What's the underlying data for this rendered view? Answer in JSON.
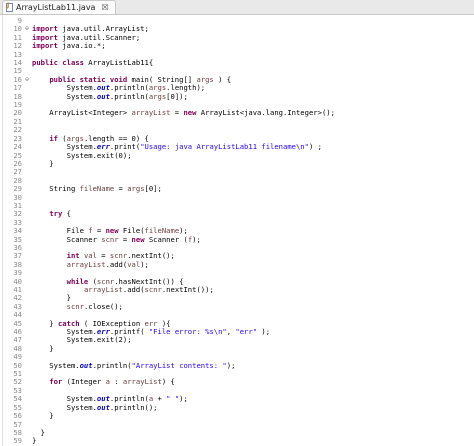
{
  "tab": {
    "title": "ArrayListLab11.java",
    "close_symbol": "☒"
  },
  "lines": [
    {
      "n": "9",
      "fold": "",
      "code": []
    },
    {
      "n": "10",
      "fold": "⊖",
      "code": [
        [
          "kw",
          "import"
        ],
        [
          "",
          "java.util.ArrayList;"
        ]
      ]
    },
    {
      "n": "11",
      "fold": "",
      "code": [
        [
          "kw",
          "import"
        ],
        [
          "",
          "java.util.Scanner;"
        ]
      ]
    },
    {
      "n": "12",
      "fold": "",
      "code": [
        [
          "kw",
          "import"
        ],
        [
          "",
          "java.io.*;"
        ]
      ]
    },
    {
      "n": "13",
      "fold": "",
      "code": []
    },
    {
      "n": "14",
      "fold": "",
      "code": [
        [
          "kw",
          "public class"
        ],
        [
          "",
          "ArrayListLab11{"
        ]
      ]
    },
    {
      "n": "15",
      "fold": "",
      "code": []
    },
    {
      "n": "16",
      "fold": "⊖",
      "code": [
        [
          "",
          "    "
        ],
        [
          "kw",
          "public static void"
        ],
        [
          "",
          "main( String[] "
        ],
        [
          "var",
          "args"
        ],
        [
          "",
          " ) {"
        ]
      ]
    },
    {
      "n": "17",
      "fold": "",
      "code": [
        [
          "",
          "        System."
        ],
        [
          "fld",
          "out"
        ],
        [
          "",
          ".println("
        ],
        [
          "var",
          "args"
        ],
        [
          "",
          ".length);"
        ]
      ]
    },
    {
      "n": "18",
      "fold": "",
      "code": [
        [
          "",
          "        System."
        ],
        [
          "fld",
          "out"
        ],
        [
          "",
          ".println("
        ],
        [
          "var",
          "args"
        ],
        [
          "",
          "[0]);"
        ]
      ]
    },
    {
      "n": "19",
      "fold": "",
      "code": []
    },
    {
      "n": "20",
      "fold": "",
      "code": [
        [
          "",
          "    ArrayList<Integer> "
        ],
        [
          "var",
          "arrayList"
        ],
        [
          "",
          " = "
        ],
        [
          "kw",
          "new"
        ],
        [
          "",
          " ArrayList<java.lang.Integer>();"
        ]
      ]
    },
    {
      "n": "21",
      "fold": "",
      "code": []
    },
    {
      "n": "22",
      "fold": "",
      "code": []
    },
    {
      "n": "23",
      "fold": "",
      "code": [
        [
          "",
          "    "
        ],
        [
          "kw",
          "if"
        ],
        [
          "",
          " ("
        ],
        [
          "var",
          "args"
        ],
        [
          "",
          ".length == 0) {"
        ]
      ]
    },
    {
      "n": "24",
      "fold": "",
      "code": [
        [
          "",
          "        System."
        ],
        [
          "fld",
          "err"
        ],
        [
          "",
          ".print("
        ],
        [
          "str",
          "\"Usage: java ArrayListLab11 filename\\n\""
        ],
        [
          "",
          ") ;"
        ]
      ]
    },
    {
      "n": "25",
      "fold": "",
      "code": [
        [
          "",
          "        System."
        ],
        [
          "",
          ""
        ],
        [
          "",
          "exit(0);"
        ]
      ]
    },
    {
      "n": "26",
      "fold": "",
      "code": [
        [
          "",
          "    }"
        ]
      ]
    },
    {
      "n": "27",
      "fold": "",
      "code": []
    },
    {
      "n": "28",
      "fold": "",
      "code": []
    },
    {
      "n": "29",
      "fold": "",
      "code": [
        [
          "",
          "    String "
        ],
        [
          "var",
          "fileName"
        ],
        [
          "",
          " = "
        ],
        [
          "var",
          "args"
        ],
        [
          "",
          "[0];"
        ]
      ]
    },
    {
      "n": "30",
      "fold": "",
      "code": []
    },
    {
      "n": "31",
      "fold": "",
      "code": []
    },
    {
      "n": "32",
      "fold": "",
      "code": [
        [
          "",
          "    "
        ],
        [
          "kw",
          "try"
        ],
        [
          "",
          " {"
        ]
      ]
    },
    {
      "n": "33",
      "fold": "",
      "code": []
    },
    {
      "n": "34",
      "fold": "",
      "code": [
        [
          "",
          "        File "
        ],
        [
          "var",
          "f"
        ],
        [
          "",
          " = "
        ],
        [
          "kw",
          "new"
        ],
        [
          "",
          " File("
        ],
        [
          "var",
          "fileName"
        ],
        [
          "",
          ");"
        ]
      ]
    },
    {
      "n": "35",
      "fold": "",
      "code": [
        [
          "",
          "        Scanner "
        ],
        [
          "var",
          "scnr"
        ],
        [
          "",
          " = "
        ],
        [
          "kw",
          "new"
        ],
        [
          "",
          " Scanner ("
        ],
        [
          "var",
          "f"
        ],
        [
          "",
          ");"
        ]
      ]
    },
    {
      "n": "36",
      "fold": "",
      "code": []
    },
    {
      "n": "37",
      "fold": "",
      "code": [
        [
          "",
          "        "
        ],
        [
          "kw",
          "int"
        ],
        [
          "",
          " "
        ],
        [
          "var",
          "val"
        ],
        [
          "",
          " = "
        ],
        [
          "var",
          "scnr"
        ],
        [
          "",
          ".nextInt();"
        ]
      ]
    },
    {
      "n": "38",
      "fold": "",
      "code": [
        [
          "",
          "        "
        ],
        [
          "var",
          "arrayList"
        ],
        [
          "",
          ".add("
        ],
        [
          "var",
          "val"
        ],
        [
          "",
          ");"
        ]
      ]
    },
    {
      "n": "39",
      "fold": "",
      "code": []
    },
    {
      "n": "40",
      "fold": "",
      "code": [
        [
          "",
          "        "
        ],
        [
          "kw",
          "while"
        ],
        [
          "",
          " ("
        ],
        [
          "var",
          "scnr"
        ],
        [
          "",
          ".hasNextInt()) {"
        ]
      ]
    },
    {
      "n": "41",
      "fold": "",
      "code": [
        [
          "",
          "            "
        ],
        [
          "var",
          "arrayList"
        ],
        [
          "",
          ".add("
        ],
        [
          "var",
          "scnr"
        ],
        [
          "",
          ".nextInt());"
        ]
      ]
    },
    {
      "n": "42",
      "fold": "",
      "code": [
        [
          "",
          "        }"
        ]
      ]
    },
    {
      "n": "43",
      "fold": "",
      "code": [
        [
          "",
          "        "
        ],
        [
          "var",
          "scnr"
        ],
        [
          "",
          ".close();"
        ]
      ]
    },
    {
      "n": "44",
      "fold": "",
      "code": []
    },
    {
      "n": "45",
      "fold": "",
      "code": [
        [
          "",
          "    } "
        ],
        [
          "kw",
          "catch"
        ],
        [
          "",
          " ( IOException "
        ],
        [
          "var",
          "err"
        ],
        [
          "",
          " ){"
        ]
      ]
    },
    {
      "n": "46",
      "fold": "",
      "code": [
        [
          "",
          "        System."
        ],
        [
          "fld",
          "err"
        ],
        [
          "",
          ".printf( "
        ],
        [
          "str",
          "\"File error: %s\\n\""
        ],
        [
          "",
          ", "
        ],
        [
          "str",
          "\"err\""
        ],
        [
          "",
          " );"
        ]
      ]
    },
    {
      "n": "47",
      "fold": "",
      "code": [
        [
          "",
          "        System."
        ],
        [
          "",
          ""
        ],
        [
          "",
          "exit(2);"
        ]
      ]
    },
    {
      "n": "48",
      "fold": "",
      "code": [
        [
          "",
          "    }"
        ]
      ]
    },
    {
      "n": "49",
      "fold": "",
      "code": []
    },
    {
      "n": "50",
      "fold": "",
      "code": [
        [
          "",
          "    System."
        ],
        [
          "fld",
          "out"
        ],
        [
          "",
          ".println("
        ],
        [
          "str",
          "\"ArrayList contents: \""
        ],
        [
          "",
          ");"
        ]
      ]
    },
    {
      "n": "51",
      "fold": "",
      "code": []
    },
    {
      "n": "52",
      "fold": "",
      "code": [
        [
          "",
          "    "
        ],
        [
          "kw",
          "for"
        ],
        [
          "",
          " (Integer "
        ],
        [
          "var",
          "a"
        ],
        [
          "",
          " : "
        ],
        [
          "var",
          "arrayList"
        ],
        [
          "",
          ") {"
        ]
      ]
    },
    {
      "n": "53",
      "fold": "",
      "code": []
    },
    {
      "n": "54",
      "fold": "",
      "code": [
        [
          "",
          "        System."
        ],
        [
          "fld",
          "out"
        ],
        [
          "",
          ".println("
        ],
        [
          "var",
          "a"
        ],
        [
          "",
          " + "
        ],
        [
          "str",
          "\" \""
        ],
        [
          "",
          ");"
        ]
      ]
    },
    {
      "n": "55",
      "fold": "",
      "code": [
        [
          "",
          "        System."
        ],
        [
          "fld",
          "out"
        ],
        [
          "",
          ".println();"
        ]
      ]
    },
    {
      "n": "56",
      "fold": "",
      "code": [
        [
          "",
          "    }"
        ]
      ]
    },
    {
      "n": "57",
      "fold": "",
      "code": []
    },
    {
      "n": "58",
      "fold": "",
      "code": [
        [
          "",
          "  }"
        ]
      ]
    },
    {
      "n": "59",
      "fold": "",
      "code": [
        [
          "",
          "}"
        ]
      ]
    }
  ]
}
